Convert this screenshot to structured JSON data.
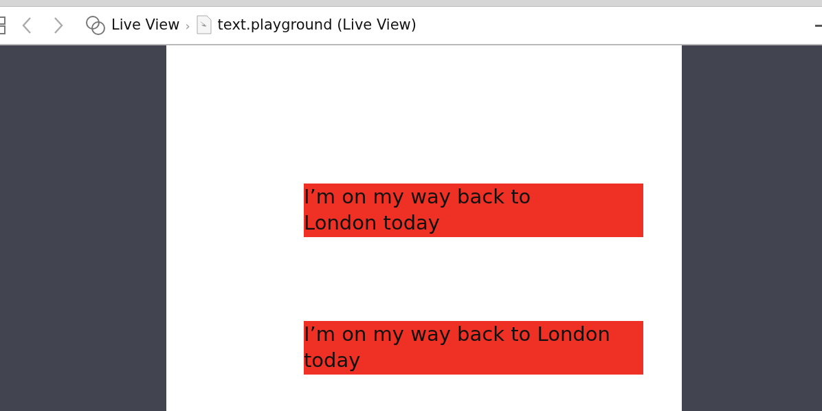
{
  "toolbar": {
    "breadcrumb": [
      {
        "label": "Live View"
      },
      {
        "label": "text.playground (Live View)"
      }
    ],
    "separator": "›"
  },
  "live_view": {
    "labels": [
      {
        "lines": [
          "I’m on my way back to",
          "London today"
        ]
      },
      {
        "lines": [
          "I’m on my way back to London",
          "today"
        ]
      }
    ]
  }
}
